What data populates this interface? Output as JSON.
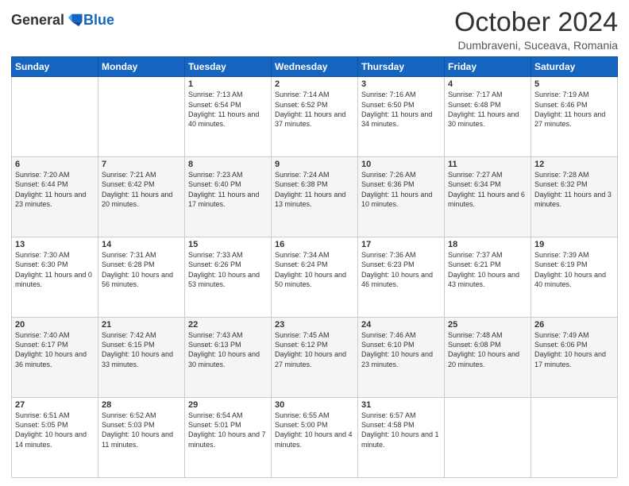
{
  "header": {
    "logo": {
      "general": "General",
      "blue": "Blue"
    },
    "title": "October 2024",
    "subtitle": "Dumbraveni, Suceava, Romania"
  },
  "weekdays": [
    "Sunday",
    "Monday",
    "Tuesday",
    "Wednesday",
    "Thursday",
    "Friday",
    "Saturday"
  ],
  "weeks": [
    [
      {
        "day": "",
        "info": ""
      },
      {
        "day": "",
        "info": ""
      },
      {
        "day": "1",
        "info": "Sunrise: 7:13 AM\nSunset: 6:54 PM\nDaylight: 11 hours and 40 minutes."
      },
      {
        "day": "2",
        "info": "Sunrise: 7:14 AM\nSunset: 6:52 PM\nDaylight: 11 hours and 37 minutes."
      },
      {
        "day": "3",
        "info": "Sunrise: 7:16 AM\nSunset: 6:50 PM\nDaylight: 11 hours and 34 minutes."
      },
      {
        "day": "4",
        "info": "Sunrise: 7:17 AM\nSunset: 6:48 PM\nDaylight: 11 hours and 30 minutes."
      },
      {
        "day": "5",
        "info": "Sunrise: 7:19 AM\nSunset: 6:46 PM\nDaylight: 11 hours and 27 minutes."
      }
    ],
    [
      {
        "day": "6",
        "info": "Sunrise: 7:20 AM\nSunset: 6:44 PM\nDaylight: 11 hours and 23 minutes."
      },
      {
        "day": "7",
        "info": "Sunrise: 7:21 AM\nSunset: 6:42 PM\nDaylight: 11 hours and 20 minutes."
      },
      {
        "day": "8",
        "info": "Sunrise: 7:23 AM\nSunset: 6:40 PM\nDaylight: 11 hours and 17 minutes."
      },
      {
        "day": "9",
        "info": "Sunrise: 7:24 AM\nSunset: 6:38 PM\nDaylight: 11 hours and 13 minutes."
      },
      {
        "day": "10",
        "info": "Sunrise: 7:26 AM\nSunset: 6:36 PM\nDaylight: 11 hours and 10 minutes."
      },
      {
        "day": "11",
        "info": "Sunrise: 7:27 AM\nSunset: 6:34 PM\nDaylight: 11 hours and 6 minutes."
      },
      {
        "day": "12",
        "info": "Sunrise: 7:28 AM\nSunset: 6:32 PM\nDaylight: 11 hours and 3 minutes."
      }
    ],
    [
      {
        "day": "13",
        "info": "Sunrise: 7:30 AM\nSunset: 6:30 PM\nDaylight: 11 hours and 0 minutes."
      },
      {
        "day": "14",
        "info": "Sunrise: 7:31 AM\nSunset: 6:28 PM\nDaylight: 10 hours and 56 minutes."
      },
      {
        "day": "15",
        "info": "Sunrise: 7:33 AM\nSunset: 6:26 PM\nDaylight: 10 hours and 53 minutes."
      },
      {
        "day": "16",
        "info": "Sunrise: 7:34 AM\nSunset: 6:24 PM\nDaylight: 10 hours and 50 minutes."
      },
      {
        "day": "17",
        "info": "Sunrise: 7:36 AM\nSunset: 6:23 PM\nDaylight: 10 hours and 46 minutes."
      },
      {
        "day": "18",
        "info": "Sunrise: 7:37 AM\nSunset: 6:21 PM\nDaylight: 10 hours and 43 minutes."
      },
      {
        "day": "19",
        "info": "Sunrise: 7:39 AM\nSunset: 6:19 PM\nDaylight: 10 hours and 40 minutes."
      }
    ],
    [
      {
        "day": "20",
        "info": "Sunrise: 7:40 AM\nSunset: 6:17 PM\nDaylight: 10 hours and 36 minutes."
      },
      {
        "day": "21",
        "info": "Sunrise: 7:42 AM\nSunset: 6:15 PM\nDaylight: 10 hours and 33 minutes."
      },
      {
        "day": "22",
        "info": "Sunrise: 7:43 AM\nSunset: 6:13 PM\nDaylight: 10 hours and 30 minutes."
      },
      {
        "day": "23",
        "info": "Sunrise: 7:45 AM\nSunset: 6:12 PM\nDaylight: 10 hours and 27 minutes."
      },
      {
        "day": "24",
        "info": "Sunrise: 7:46 AM\nSunset: 6:10 PM\nDaylight: 10 hours and 23 minutes."
      },
      {
        "day": "25",
        "info": "Sunrise: 7:48 AM\nSunset: 6:08 PM\nDaylight: 10 hours and 20 minutes."
      },
      {
        "day": "26",
        "info": "Sunrise: 7:49 AM\nSunset: 6:06 PM\nDaylight: 10 hours and 17 minutes."
      }
    ],
    [
      {
        "day": "27",
        "info": "Sunrise: 6:51 AM\nSunset: 5:05 PM\nDaylight: 10 hours and 14 minutes."
      },
      {
        "day": "28",
        "info": "Sunrise: 6:52 AM\nSunset: 5:03 PM\nDaylight: 10 hours and 11 minutes."
      },
      {
        "day": "29",
        "info": "Sunrise: 6:54 AM\nSunset: 5:01 PM\nDaylight: 10 hours and 7 minutes."
      },
      {
        "day": "30",
        "info": "Sunrise: 6:55 AM\nSunset: 5:00 PM\nDaylight: 10 hours and 4 minutes."
      },
      {
        "day": "31",
        "info": "Sunrise: 6:57 AM\nSunset: 4:58 PM\nDaylight: 10 hours and 1 minute."
      },
      {
        "day": "",
        "info": ""
      },
      {
        "day": "",
        "info": ""
      }
    ]
  ]
}
